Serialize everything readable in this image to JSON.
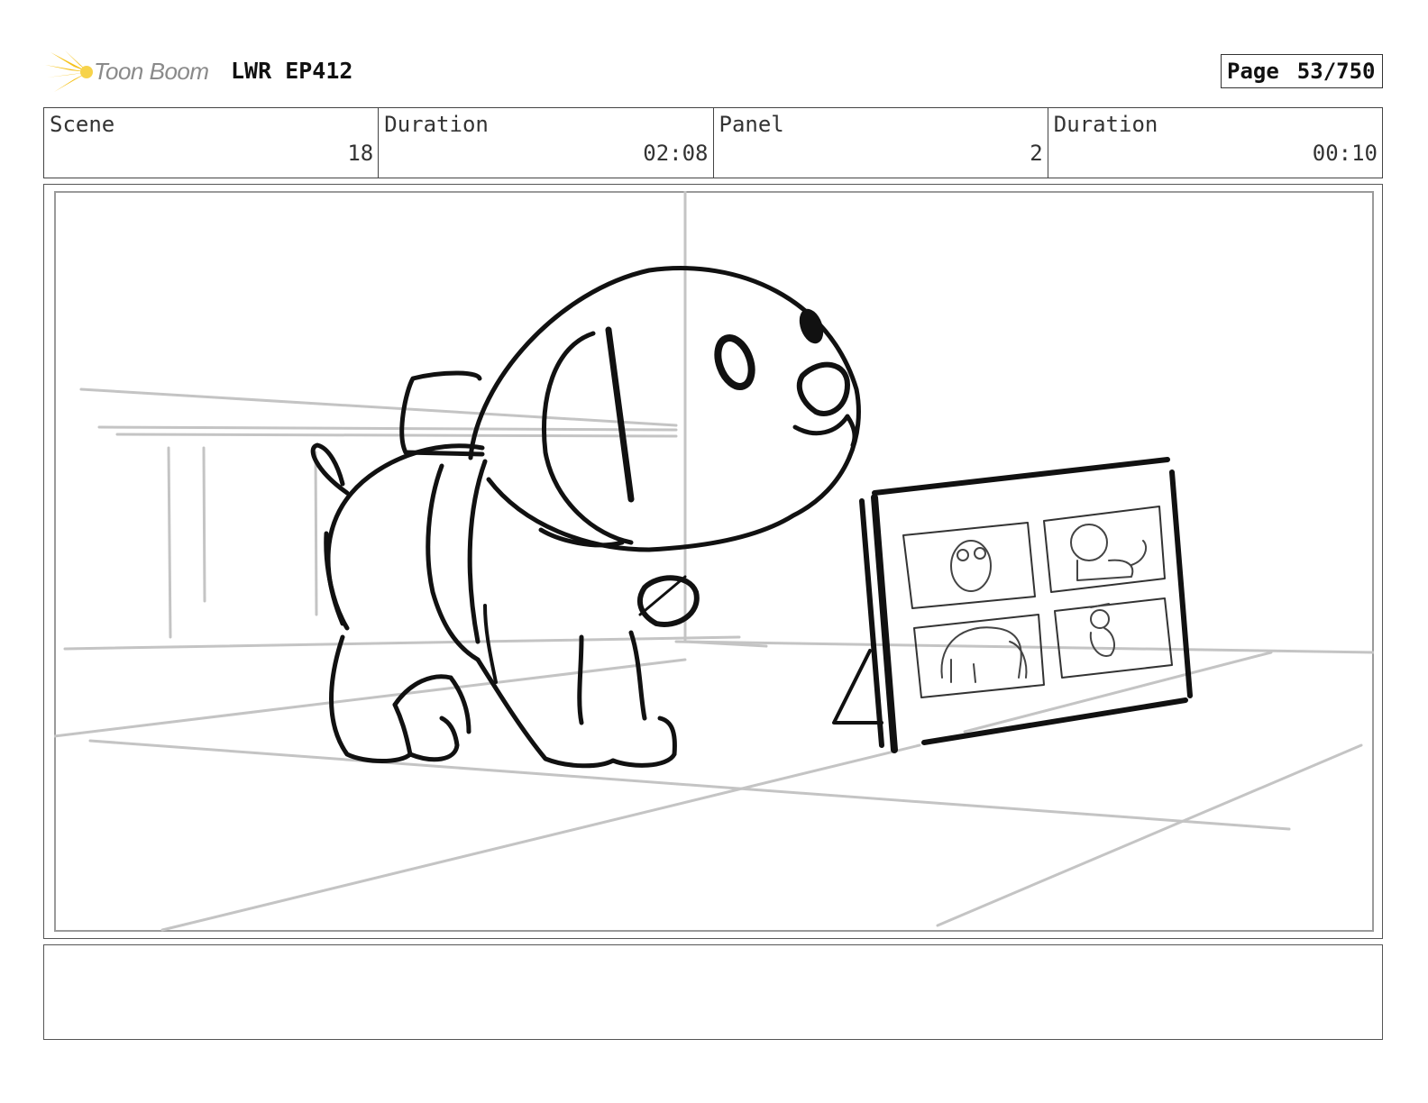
{
  "header": {
    "logo_text": "Toon Boom",
    "project_title": "LWR EP412",
    "page_label": "Page",
    "page_number": "53/750"
  },
  "info": {
    "scene_label": "Scene",
    "scene_value": "18",
    "scene_duration_label": "Duration",
    "scene_duration_value": "02:08",
    "panel_label": "Panel",
    "panel_value": "2",
    "panel_duration_label": "Duration",
    "panel_duration_value": "00:10"
  },
  "colors": {
    "logo_accent": "#f5c21b",
    "sketch_line": "#111111",
    "background_line": "#bdbdbd"
  },
  "notes": {
    "text": ""
  }
}
